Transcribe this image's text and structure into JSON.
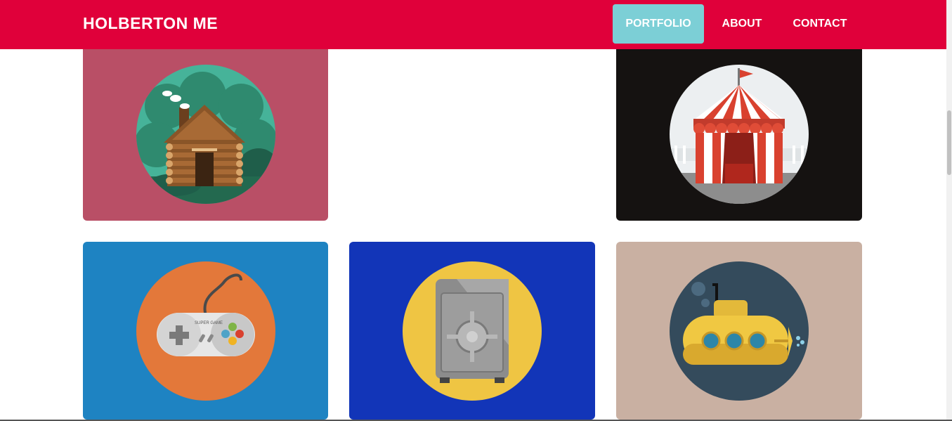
{
  "header": {
    "brand": "HOLBERTON ME",
    "nav": [
      {
        "label": "PORTFOLIO",
        "active": true
      },
      {
        "label": "ABOUT",
        "active": false
      },
      {
        "label": "CONTACT",
        "active": false
      }
    ],
    "colors": {
      "bar": "#e0003a",
      "active_tab": "#7ccfd6"
    }
  },
  "portfolio": {
    "cards": [
      {
        "icon": "log-cabin-icon",
        "bg": "#b94f66"
      },
      {
        "icon": "circus-tent-icon",
        "bg": "#151211"
      },
      {
        "icon": "game-controller-icon",
        "bg": "#1e83c2",
        "controller_text": "SUPER GAME"
      },
      {
        "icon": "safe-icon",
        "bg": "#1235b8"
      },
      {
        "icon": "submarine-icon",
        "bg": "#c9b0a2"
      }
    ]
  }
}
